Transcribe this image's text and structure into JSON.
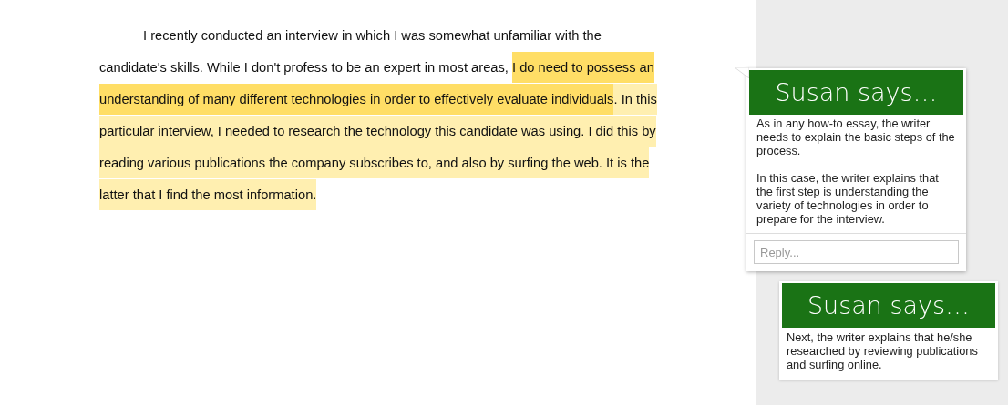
{
  "document": {
    "paragraph": [
      {
        "text": "I recently conducted an interview in which I was somewhat unfamiliar with the candidate's skills. While I don't profess to be an expert in most areas, "
      },
      {
        "text": "I do need to possess an understanding of many different technologies in order to effectively evaluate individuals",
        "color": "#ffde66"
      },
      {
        "text": ". In this particular interview, I needed to research the technology this candidate was using. I did this by reading various publications the company subscribes to, and also by surfing the web. It is the latter that I find the most information.",
        "color": "#ffefb0"
      }
    ]
  },
  "comments": [
    {
      "header": "Susan says…",
      "active": true,
      "paragraphs": [
        "As in any how-to essay, the writer needs to explain the basic steps of the process.",
        "In this case, the writer explains that the first step is understanding the variety of technologies in order to prepare for the interview."
      ],
      "reply": {
        "placeholder": "Reply..."
      }
    },
    {
      "header": "Susan says…",
      "active": false,
      "paragraphs": [
        "Next, the writer explains that he/she researched by reviewing publications and surfing online."
      ]
    }
  ]
}
